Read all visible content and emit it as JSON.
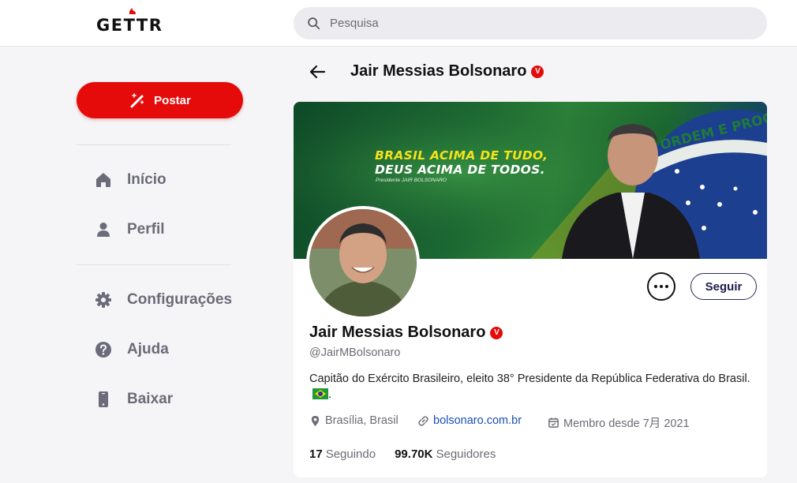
{
  "brand": {
    "logo_text": "GETTR"
  },
  "search": {
    "placeholder": "Pesquisa"
  },
  "sidebar": {
    "post_label": "Postar",
    "items": [
      {
        "label": "Início",
        "icon": "home-icon"
      },
      {
        "label": "Perfil",
        "icon": "user-icon"
      },
      {
        "label": "Configurações",
        "icon": "gear-icon"
      },
      {
        "label": "Ajuda",
        "icon": "help-icon"
      },
      {
        "label": "Baixar",
        "icon": "phone-icon"
      }
    ]
  },
  "header": {
    "title": "Jair Messias Bolsonaro",
    "verified_badge": "V"
  },
  "banner": {
    "line1": "BRASIL ACIMA DE TUDO,",
    "line2": "DEUS ACIMA DE TODOS.",
    "caption": "Presidente JAIR BOLSONARO",
    "flag_motto": "ORDEM E PROGRESSO"
  },
  "profile": {
    "name": "Jair Messias Bolsonaro",
    "verified_badge": "V",
    "handle": "@JairMBolsonaro",
    "bio": "Capitão do Exército Brasileiro, eleito 38° Presidente da República Federativa do Brasil.",
    "bio_end": ".",
    "location": "Brasília, Brasil",
    "website": "bolsonaro.com.br",
    "joined": "Membro desde 7月 2021",
    "follow_label": "Seguir",
    "following_count": "17",
    "following_label": "Seguindo",
    "followers_count": "99.70K",
    "followers_label": "Seguidores"
  },
  "colors": {
    "accent": "#e50b0b",
    "link": "#1a4fb8",
    "muted": "#6b6b79"
  }
}
